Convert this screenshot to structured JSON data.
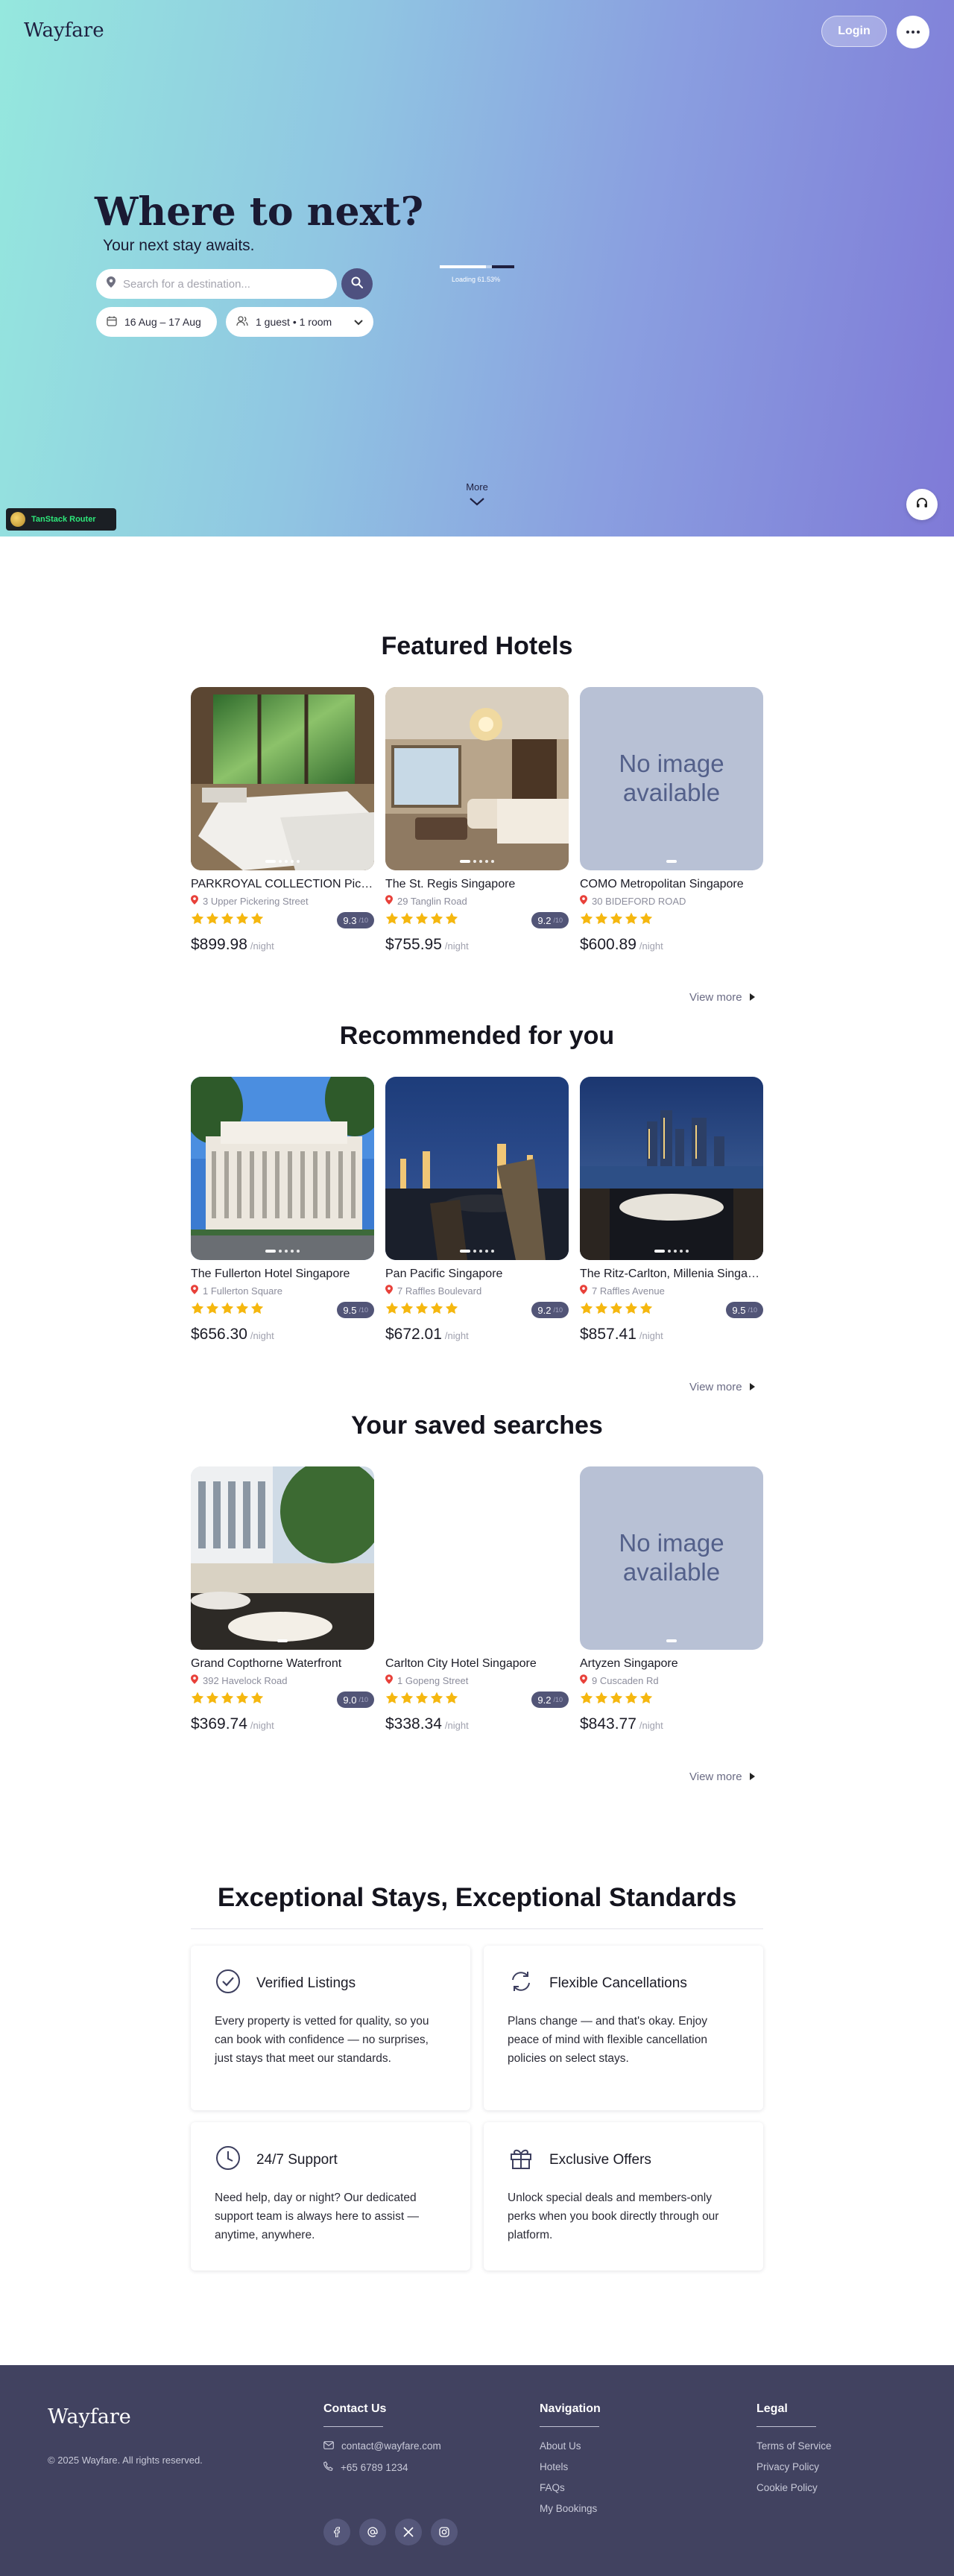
{
  "header": {
    "logo": "Wayfare",
    "login_label": "Login",
    "more_icon": "ellipsis-icon"
  },
  "hero": {
    "title": "Where to next?",
    "subtitle": "Your next stay awaits.",
    "search_placeholder": "Search for a destination...",
    "dates": "16 Aug – 17 Aug",
    "guests": "1 guest • 1 room",
    "loading_text": "Loading 61.53%",
    "loading_progress": 0.6153,
    "more_label": "More"
  },
  "devtools": {
    "label": "TanStack Router"
  },
  "featured": {
    "title": "Featured Hotels",
    "view_more": "View more",
    "hotels": [
      {
        "name": "PARKROYAL COLLECTION Pickering, Singapore",
        "address": "3 Upper Pickering Street",
        "rating": "9.3",
        "rating_max": "/10",
        "stars": 5,
        "price": "$899.98",
        "unit": "/night",
        "image": "room-garden"
      },
      {
        "name": "The St. Regis Singapore",
        "address": "29 Tanglin Road",
        "rating": "9.2",
        "rating_max": "/10",
        "stars": 5,
        "price": "$755.95",
        "unit": "/night",
        "image": "room-chandelier"
      },
      {
        "name": "COMO Metropolitan Singapore",
        "address": "30 BIDEFORD ROAD",
        "rating": "",
        "rating_max": "",
        "stars": 5,
        "price": "$600.89",
        "unit": "/night",
        "image": "none",
        "no_image_text": "No image available"
      }
    ]
  },
  "recommended": {
    "title": "Recommended for you",
    "view_more": "View more",
    "hotels": [
      {
        "name": "The Fullerton Hotel Singapore",
        "address": "1 Fullerton Square",
        "rating": "9.5",
        "rating_max": "/10",
        "stars": 5,
        "price": "$656.30",
        "unit": "/night",
        "image": "fullerton"
      },
      {
        "name": "Pan Pacific Singapore",
        "address": "7 Raffles Boulevard",
        "rating": "9.2",
        "rating_max": "/10",
        "stars": 5,
        "price": "$672.01",
        "unit": "/night",
        "image": "night-terrace"
      },
      {
        "name": "The Ritz-Carlton, Millenia Singapore",
        "address": "7 Raffles Avenue",
        "rating": "9.5",
        "rating_max": "/10",
        "stars": 5,
        "price": "$857.41",
        "unit": "/night",
        "image": "skyline-dinner"
      }
    ]
  },
  "saved": {
    "title": "Your saved searches",
    "view_more": "View more",
    "hotels": [
      {
        "name": "Grand Copthorne Waterfront",
        "address": "392 Havelock Road",
        "rating": "9.0",
        "rating_max": "/10",
        "stars": 5,
        "price": "$369.74",
        "unit": "/night",
        "image": "waterfront"
      },
      {
        "name": "Carlton City Hotel Singapore",
        "address": "1 Gopeng Street",
        "rating": "9.2",
        "rating_max": "/10",
        "stars": 5,
        "price": "$338.34",
        "unit": "/night",
        "image": "blank"
      },
      {
        "name": "Artyzen Singapore",
        "address": "9 Cuscaden Rd",
        "rating": "",
        "rating_max": "",
        "stars": 5,
        "price": "$843.77",
        "unit": "/night",
        "image": "none",
        "no_image_text": "No image available"
      }
    ]
  },
  "features": {
    "title": "Exceptional Stays, Exceptional Standards",
    "items": [
      {
        "icon": "check-circle-icon",
        "title": "Verified Listings",
        "text": "Every property is vetted for quality, so you can book with confidence — no surprises, just stays that meet our standards."
      },
      {
        "icon": "refresh-icon",
        "title": "Flexible Cancellations",
        "text": "Plans change — and that's okay. Enjoy peace of mind with flexible cancellation policies on select stays."
      },
      {
        "icon": "clock-icon",
        "title": "24/7 Support",
        "text": "Need help, day or night? Our dedicated support team is always here to assist — anytime, anywhere."
      },
      {
        "icon": "gift-icon",
        "title": "Exclusive Offers",
        "text": "Unlock special deals and members-only perks when you book directly through our platform."
      }
    ]
  },
  "footer": {
    "logo": "Wayfare",
    "copyright": "© 2025 Wayfare. All rights reserved.",
    "contact": {
      "title": "Contact Us",
      "email": "contact@wayfare.com",
      "phone": "+65 6789 1234"
    },
    "navigation": {
      "title": "Navigation",
      "links": [
        "About Us",
        "Hotels",
        "FAQs",
        "My Bookings"
      ]
    },
    "legal": {
      "title": "Legal",
      "links": [
        "Terms of Service",
        "Privacy Policy",
        "Cookie Policy"
      ]
    },
    "socials": [
      "facebook-icon",
      "threads-icon",
      "x-icon",
      "instagram-icon"
    ]
  },
  "colors": {
    "accent": "#4e5180",
    "badge": "#525577",
    "star": "#f5b70f",
    "footer": "#414260",
    "pin": "#e8413a"
  }
}
